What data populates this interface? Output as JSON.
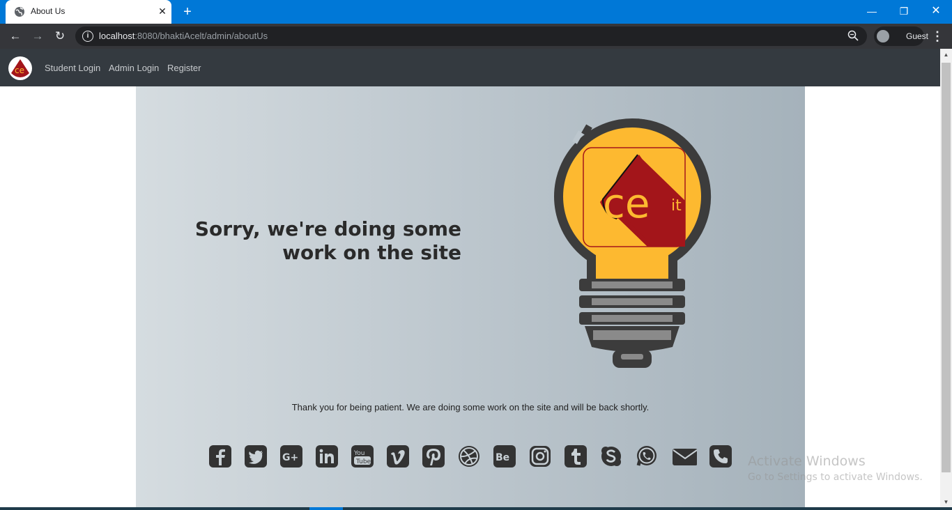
{
  "browser": {
    "tab_title": "About Us",
    "new_tab_symbol": "+",
    "url_host": "localhost",
    "url_rest": ":8080/bhaktiAcelt/admin/aboutUs",
    "profile_name": "Guest"
  },
  "site_nav": {
    "links": [
      "Student Login",
      "Admin Login",
      "Register"
    ]
  },
  "hero": {
    "headline_line1": "Sorry, we're doing some",
    "headline_line2": "work on the site",
    "message": "Thank you for being patient. We are doing some work on the site and will be back shortly.",
    "logo_text": "ce",
    "logo_suffix": "it"
  },
  "social_icons": [
    "facebook-icon",
    "twitter-icon",
    "google-plus-icon",
    "linkedin-icon",
    "youtube-icon",
    "vimeo-icon",
    "pinterest-icon",
    "dribbble-icon",
    "behance-icon",
    "instagram-icon",
    "tumblr-icon",
    "skype-icon",
    "whatsapp-icon",
    "email-icon",
    "phone-icon"
  ],
  "youtube_label": "You Tube",
  "behance_label": "Be",
  "windows_watermark": {
    "line1": "Activate Windows",
    "line2": "Go to Settings to activate Windows."
  },
  "colors": {
    "titlebar": "#0078d7",
    "navbar": "#343a40",
    "bulb_yellow": "#fdb930",
    "logo_red": "#a3151a"
  }
}
